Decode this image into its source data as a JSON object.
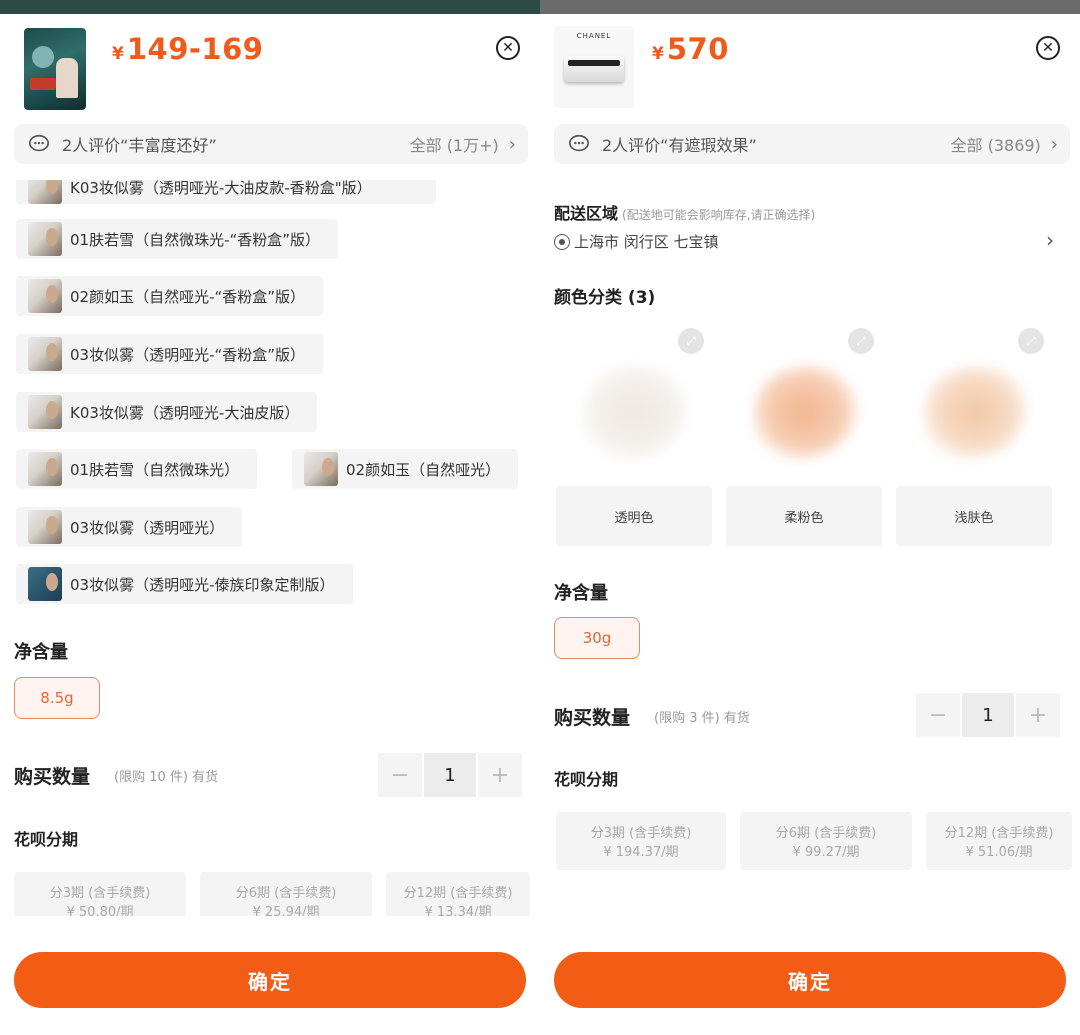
{
  "left": {
    "price": {
      "currency": "¥",
      "amount": "149-169"
    },
    "review": {
      "summary": "2人评价“丰富度还好”",
      "all": "全部 (1万+)"
    },
    "partial_variant": "K03妆似雾（透明哑光-大油皮款-香粉盒\"版）",
    "variants": [
      "01肤若雪（自然微珠光-“香粉盒”版）",
      "02颜如玉（自然哑光-“香粉盒”版）",
      "03妆似雾（透明哑光-“香粉盒”版）",
      "K03妆似雾（透明哑光-大油皮版）",
      "01肤若雪（自然微珠光）",
      "02颜如玉（自然哑光）",
      "03妆似雾（透明哑光）",
      "03妆似雾（透明哑光-傣族印象定制版）"
    ],
    "net_title": "净含量",
    "net_option": "8.5g",
    "qty_label": "购买数量",
    "qty_note": "(限购 10 件) 有货",
    "qty_value": "1",
    "installment_title": "花呗分期",
    "installments": [
      {
        "label": "分3期 (含手续费)",
        "amount": "¥ 50.80/期"
      },
      {
        "label": "分6期 (含手续费)",
        "amount": "¥ 25.94/期"
      },
      {
        "label": "分12期 (含手续费)",
        "amount": "¥ 13.34/期"
      }
    ],
    "confirm": "确定"
  },
  "right": {
    "brand": "CHANEL",
    "price": {
      "currency": "¥",
      "amount": "570"
    },
    "review": {
      "summary": "2人评价“有遮瑕效果”",
      "all": "全部 (3869)"
    },
    "shipping_title": "配送区域",
    "shipping_note": "(配送地可能会影响库存,请正确选择)",
    "shipping_address": "上海市 闵行区 七宝镇",
    "color_title": "颜色分类 (3)",
    "colors": [
      {
        "label": "透明色",
        "hex": "#f2f0ea"
      },
      {
        "label": "柔粉色",
        "hex": "#f3c6a8"
      },
      {
        "label": "浅肤色",
        "hex": "#f5d4bb"
      }
    ],
    "net_title": "净含量",
    "net_option": "30g",
    "qty_label": "购买数量",
    "qty_note": "(限购 3 件) 有货",
    "qty_value": "1",
    "installment_title": "花呗分期",
    "installments": [
      {
        "label": "分3期 (含手续费)",
        "amount": "¥ 194.37/期"
      },
      {
        "label": "分6期 (含手续费)",
        "amount": "¥ 99.27/期"
      },
      {
        "label": "分12期 (含手续费)",
        "amount": "¥ 51.06/期"
      }
    ],
    "confirm": "确定"
  },
  "colors": {
    "accent": "#f25c14",
    "price": "#f05a1a",
    "chip_border": "#e98b6a"
  }
}
